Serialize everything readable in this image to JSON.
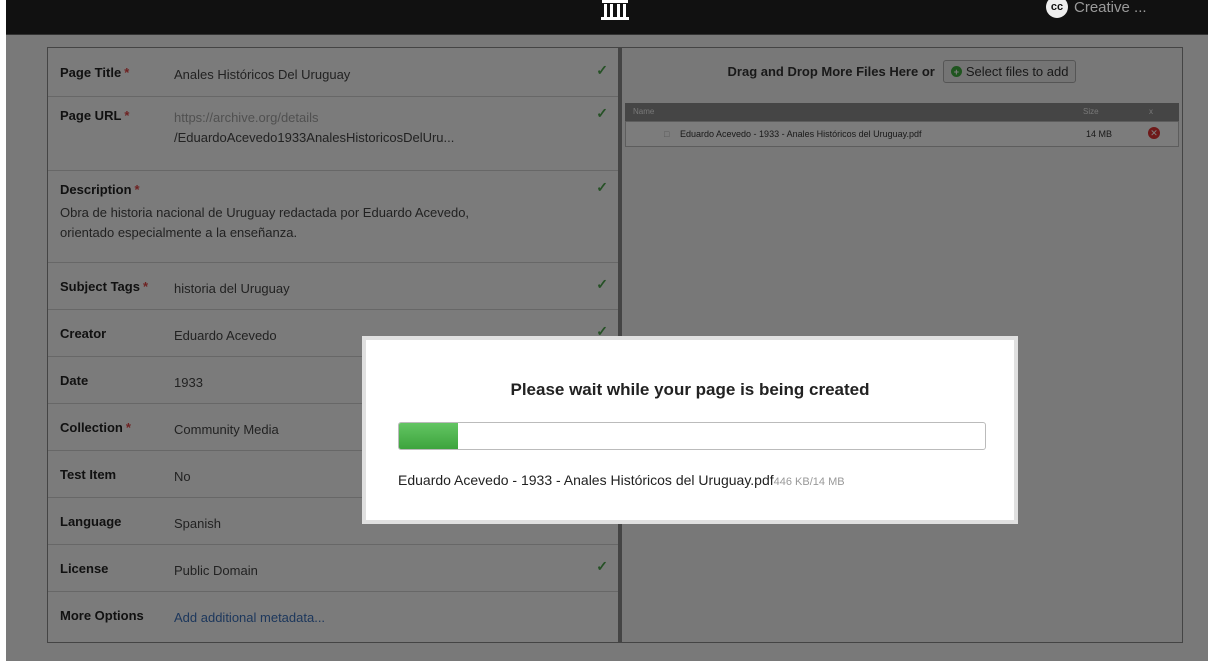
{
  "topbar": {
    "cc_badge": "cc",
    "cc_label": "Creative ..."
  },
  "form": {
    "rows": [
      {
        "label": "Page Title",
        "required": true,
        "value": "Anales Históricos Del Uruguay",
        "check": true
      },
      {
        "label": "Page URL",
        "required": true,
        "value_line1": "https://archive.org/details",
        "value_line2": "/EduardoAcevedo1933AnalesHistoricosDelUru...",
        "check": true
      },
      {
        "label": "Description",
        "required": true,
        "value_line1": "Obra de historia nacional de Uruguay redactada por Eduardo Acevedo,",
        "value_line2": "orientado especialmente a la enseñanza.",
        "check": true
      },
      {
        "label": "Subject Tags",
        "required": true,
        "value": "historia del Uruguay",
        "check": true
      },
      {
        "label": "Creator",
        "required": false,
        "value": "Eduardo Acevedo",
        "check": true
      },
      {
        "label": "Date",
        "required": false,
        "value": "1933",
        "check": false
      },
      {
        "label": "Collection",
        "required": true,
        "value": "Community Media",
        "check": false
      },
      {
        "label": "Test Item",
        "required": false,
        "value": "No",
        "check": false
      },
      {
        "label": "Language",
        "required": false,
        "value": "Spanish",
        "check": false
      },
      {
        "label": "License",
        "required": false,
        "value": "Public Domain",
        "check": true
      },
      {
        "label": "More Options",
        "required": false,
        "value": "Add additional metadata...",
        "check": false
      }
    ],
    "required_mark": "*",
    "check_mark": "✓"
  },
  "files": {
    "drop_text": "Drag and Drop More Files Here or",
    "select_button": "Select files to add",
    "columns": {
      "name": "Name",
      "size": "Size",
      "remove": "x"
    },
    "items": [
      {
        "name": "Eduardo Acevedo - 1933 - Anales Históricos del Uruguay.pdf",
        "size": "14 MB"
      }
    ]
  },
  "modal": {
    "title": "Please wait while your page is being created",
    "progress_fraction": 0.1,
    "file_name": "Eduardo Acevedo - 1933 - Anales Históricos del Uruguay.pdf",
    "progress_text": "446 KB/14 MB"
  },
  "colors": {
    "accent_green": "#3da43d",
    "required_red": "#dd4444",
    "link_blue": "#3a6fb8"
  }
}
